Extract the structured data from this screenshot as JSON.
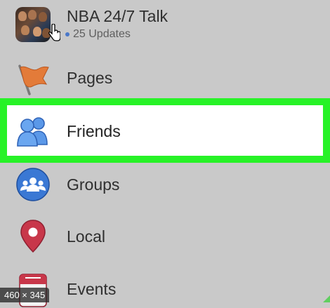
{
  "menu": {
    "group": {
      "title": "NBA 24/7 Talk",
      "updates": "25 Updates"
    },
    "items": [
      {
        "label": "Pages",
        "icon": "flag-icon"
      },
      {
        "label": "Friends",
        "icon": "friends-icon"
      },
      {
        "label": "Groups",
        "icon": "groups-icon"
      },
      {
        "label": "Local",
        "icon": "map-pin-icon"
      },
      {
        "label": "Events",
        "icon": "calendar-icon"
      }
    ]
  },
  "overlay": {
    "image_size": "460 × 345"
  },
  "colors": {
    "highlight": "#27f227",
    "accent_blue": "#3a78d4",
    "pin_red": "#c8374a",
    "flag_orange": "#e37b39"
  }
}
